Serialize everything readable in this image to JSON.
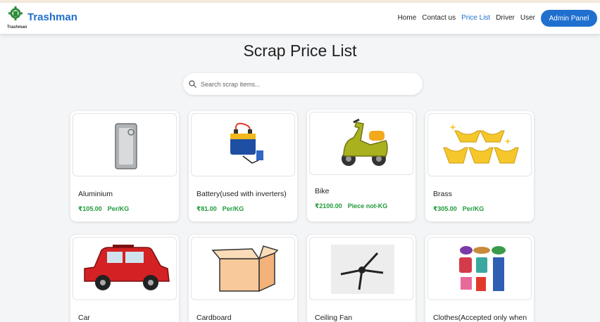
{
  "nav": {
    "brand": "Trashman",
    "logo_sub": "Trashman",
    "links": [
      "Home",
      "Contact us",
      "Price List",
      "Driver",
      "User"
    ],
    "active": "Price List",
    "admin_label": "Admin Panel"
  },
  "page": {
    "title": "Scrap Price List",
    "search_placeholder": "Search scrap items..."
  },
  "items": [
    {
      "name": "Aluminium",
      "price": "₹105.00",
      "unit": "Per/KG",
      "icon": "aluminium-icon"
    },
    {
      "name": "Battery(used with inverters)",
      "price": "₹81.00",
      "unit": "Per/KG",
      "icon": "battery-icon"
    },
    {
      "name": "Bike",
      "price": "₹2100.00",
      "unit": "Piece not-KG",
      "icon": "bike-icon"
    },
    {
      "name": "Brass",
      "price": "₹305.00",
      "unit": "Per/KG",
      "icon": "brass-icon"
    },
    {
      "name": "Car",
      "icon": "car-icon"
    },
    {
      "name": "Cardboard",
      "icon": "cardboard-icon"
    },
    {
      "name": "Ceiling Fan",
      "icon": "ceiling-fan-icon"
    },
    {
      "name": "Clothes(Accepted only when",
      "icon": "clothes-icon"
    }
  ],
  "colors": {
    "accent": "#1f6fcf",
    "price": "#1f9a3a",
    "background": "#f4f5f7"
  }
}
